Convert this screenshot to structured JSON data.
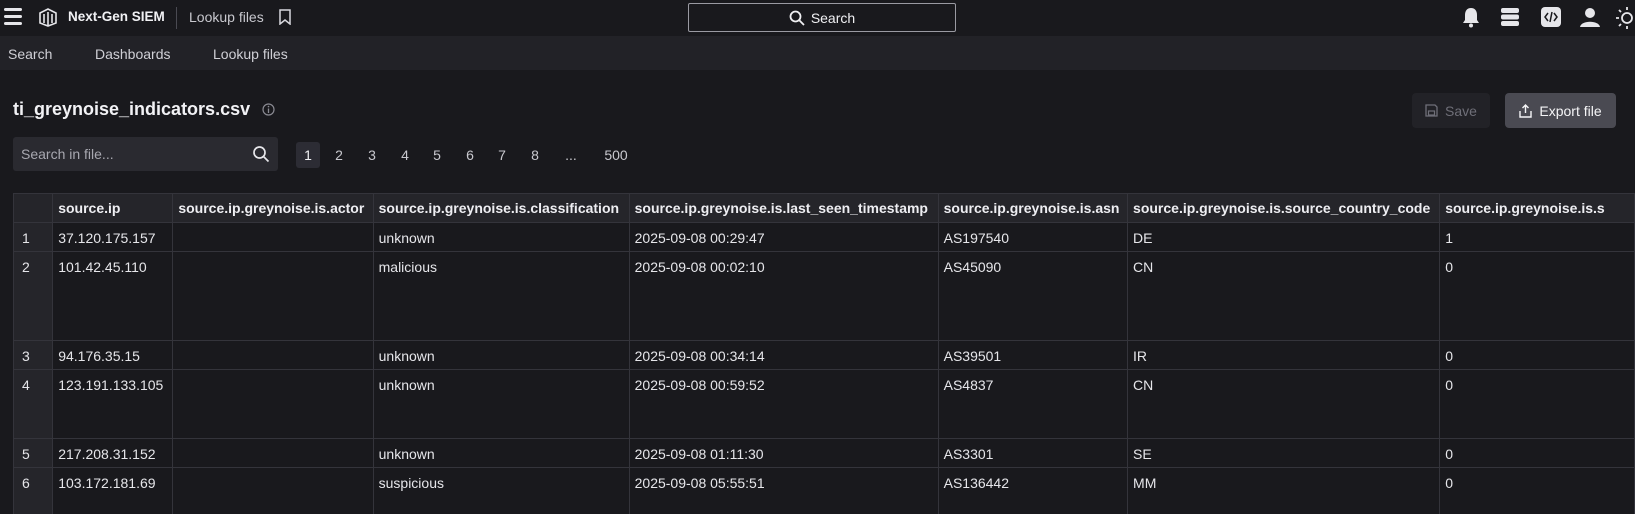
{
  "header": {
    "app_name": "Next-Gen SIEM",
    "breadcrumb": "Lookup files",
    "search_label": "Search"
  },
  "nav": {
    "items": [
      "Search",
      "Dashboards",
      "Lookup files"
    ]
  },
  "file": {
    "name": "ti_greynoise_indicators.csv",
    "save_label": "Save",
    "export_label": "Export file",
    "search_placeholder": "Search in file..."
  },
  "pagination": {
    "pages": [
      "1",
      "2",
      "3",
      "4",
      "5",
      "6",
      "7",
      "8",
      "...",
      "500"
    ],
    "current": "1"
  },
  "table": {
    "columns": [
      "source.ip",
      "source.ip.greynoise.is.actor",
      "source.ip.greynoise.is.classification",
      "source.ip.greynoise.is.last_seen_timestamp",
      "source.ip.greynoise.is.asn",
      "source.ip.greynoise.is.source_country_code",
      "source.ip.greynoise.is.s"
    ],
    "rows": [
      {
        "n": "1",
        "cells": [
          "37.120.175.157",
          "",
          "unknown",
          "2025-09-08 00:29:47",
          "AS197540",
          "DE",
          "1"
        ]
      },
      {
        "n": "2",
        "cells": [
          "101.42.45.110",
          "",
          "malicious",
          "2025-09-08 00:02:10",
          "AS45090",
          "CN",
          "0"
        ]
      },
      {
        "n": "3",
        "cells": [
          "94.176.35.15",
          "",
          "unknown",
          "2025-09-08 00:34:14",
          "AS39501",
          "IR",
          "0"
        ]
      },
      {
        "n": "4",
        "cells": [
          "123.191.133.105",
          "",
          "unknown",
          "2025-09-08 00:59:52",
          "AS4837",
          "CN",
          "0"
        ]
      },
      {
        "n": "5",
        "cells": [
          "217.208.31.152",
          "",
          "unknown",
          "2025-09-08 01:11:30",
          "AS3301",
          "SE",
          "0"
        ]
      },
      {
        "n": "6",
        "cells": [
          "103.172.181.69",
          "",
          "suspicious",
          "2025-09-08 05:55:51",
          "AS136442",
          "MM",
          "0"
        ]
      }
    ]
  },
  "icons": [
    "menu-icon",
    "logo-icon",
    "bookmark-icon",
    "search-icon",
    "bell-icon",
    "stack-icon",
    "code-icon",
    "user-icon",
    "sun-icon",
    "info-icon",
    "save-icon",
    "export-icon"
  ],
  "colors": {
    "background": "#19191d",
    "nav": "#222227",
    "export_button": "#4a4a52"
  }
}
